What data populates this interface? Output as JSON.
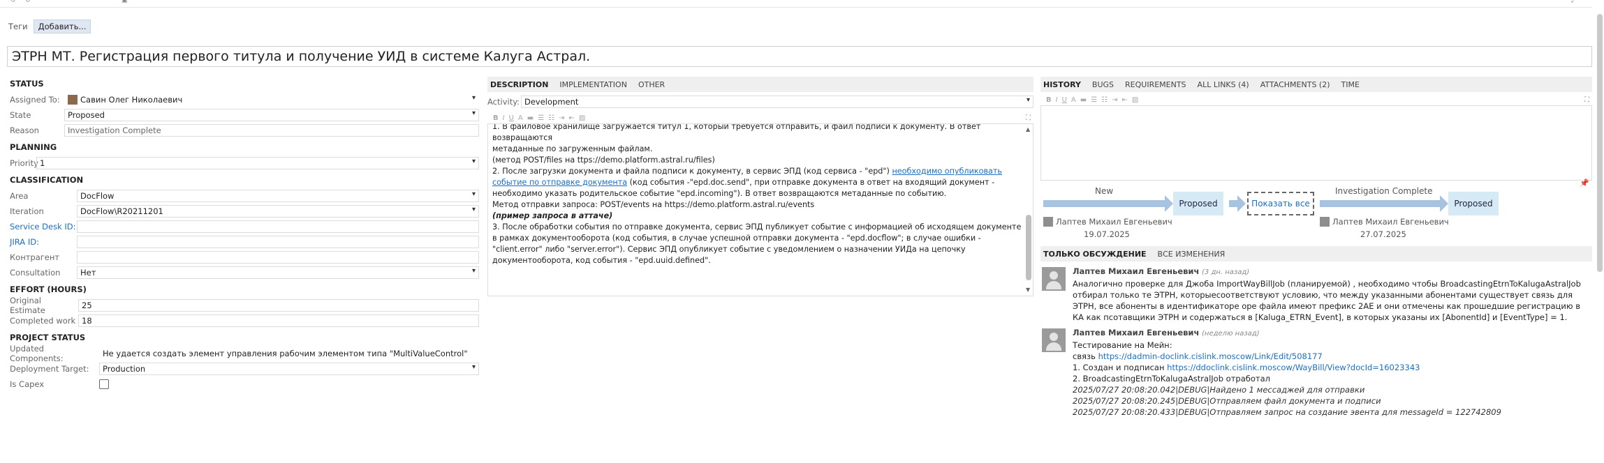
{
  "tags": {
    "label": "Теги",
    "add_button": "Добавить..."
  },
  "title": "ЭТРН МТ. Регистрация первого титула и получение УИД в системе Калуга Астрал.",
  "left": {
    "status_header": "STATUS",
    "assigned_to": {
      "label": "Assigned To:",
      "value": "Савин Олег Николаевич"
    },
    "state": {
      "label": "State",
      "value": "Proposed"
    },
    "reason": {
      "label": "Reason",
      "value": "Investigation Complete"
    },
    "planning_header": "PLANNING",
    "priority": {
      "label": "Priority",
      "value": "1"
    },
    "classification_header": "CLASSIFICATION",
    "area": {
      "label": "Area",
      "value": "DocFlow"
    },
    "iteration": {
      "label": "Iteration",
      "value": "DocFlow\\R20211201"
    },
    "service_desk_id": {
      "label": "Service Desk ID:",
      "value": ""
    },
    "jira_id": {
      "label": "JIRA ID:",
      "value": ""
    },
    "kontragent": {
      "label": "Контрагент",
      "value": ""
    },
    "consultation": {
      "label": "Consultation",
      "value": "Нет"
    },
    "effort_header": "EFFORT (HOURS)",
    "original_estimate": {
      "label": "Original Estimate",
      "value": "25"
    },
    "completed_work": {
      "label": "Completed work",
      "value": "18"
    },
    "project_status_header": "PROJECT STATUS",
    "updated_components": {
      "label": "Updated Components:",
      "value": "Не удается создать элемент управления рабочим элементом типа \"MultiValueControl\""
    },
    "deployment_target": {
      "label": "Deployment Target:",
      "value": "Production"
    },
    "is_capex": {
      "label": "Is Capex"
    }
  },
  "mid": {
    "tabs": [
      "DESCRIPTION",
      "IMPLEMENTATION",
      "OTHER"
    ],
    "activity": {
      "label": "Activity:",
      "value": "Development"
    },
    "desc": {
      "line1": "1. В файловое хранилище загружается титул 1, который требуется отправить, и файл подписи к документу. В ответ возвращаются",
      "line2": "метаданные по загруженным файлам.",
      "line3": " (метод POST/files на ttps://demo.platform.astral.ru/files)",
      "line4_pre": "2. После загрузки документа и файла подписи к документу, в сервис ЭПД (код сервиса - \"epd\") ",
      "line4_link": "необходимо опубликовать событие по отправке документа",
      "line4_post": " (код события -\"epd.doc.send\", при отправке документа в ответ на входящий документ - необходимо указать родительское событие \"epd.incoming\"). В ответ возвращаются метаданные по событию.",
      "line5": "Метод отправки запроса: POST/events на https://demo.platform.astral.ru/events",
      "line6": "(пример запроса в аттаче)",
      "line7": "3. После обработки события по отправке документа, сервис ЭПД публикует событие с информацией об исходящем документе в рамках документооборота (код события, в случае успешной отправки документа - \"epd.docflow\"; в случае ошибки - \"client.error\" либо \"server.error\"). Сервис ЭПД опубликует событие с уведомлением о назначении УИДа на цепочку документооборота, код события - \"epd.uuid.defined\"."
    }
  },
  "right": {
    "tabs": [
      "HISTORY",
      "BUGS",
      "REQUIREMENTS",
      "ALL LINKS (4)",
      "ATTACHMENTS (2)",
      "TIME"
    ],
    "flow": {
      "t1_label": "New",
      "s1": "Proposed",
      "show_all": "Показать все",
      "t2_label": "Investigation Complete",
      "s2": "Proposed",
      "who1": "Лаптев Михаил Евгеньевич",
      "date1": "19.07.2025",
      "who2": "Лаптев Михаил Евгеньевич",
      "date2": "27.07.2025"
    },
    "disc_tabs": [
      "ТОЛЬКО ОБСУЖДЕНИЕ",
      "ВСЕ ИЗМЕНЕНИЯ"
    ],
    "c1": {
      "author": "Лаптев Михаил Евгеньевич",
      "ago": "(3 дн. назад)",
      "text": "Аналогично проверке для Джоба ImportWayBillJob (планируемой) , необходимо чтобы BroadcastingEtrnToKalugaAstralJob  отбирал только те  ЭТРН, которыесоответствуют условию, что между указанными абонентами существует связь для ЭТРН, все абоненты в идентификаторе ope файла имеют префикс 2AE и они отмечены как прошедшие регистрацию в КА как псотавщики ЭТРН и содержаться в [Kaluga_ETRN_Event], в которых указаны их [AbonentId] и [EventType] = 1."
    },
    "c2": {
      "author": "Лаптев Михаил Евгеньевич",
      "ago": "(неделю назад)",
      "l1": "Тестирование на Мейн:",
      "l2_pre": "связь ",
      "l2_link": "https://dadmin-doclink.cislink.moscow/Link/Edit/508177",
      "l3_pre": "1. Создан и подписан ",
      "l3_link": "https://ddoclink.cislink.moscow/WayBill/View?docId=16023343",
      "l4": "2. BroadcastingEtrnToKalugaAstralJob отработал",
      "l5": "2025/07/27 20:08:20.042|DEBUG|Найдено 1 мессаджей для отправки",
      "l6": "2025/07/27 20:08:20.245|DEBUG|Отправляем файл документа и подписи",
      "l7": "2025/07/27 20:08:20.433|DEBUG|Отправляем запрос на создание эвента для messageId = 122742809"
    }
  }
}
